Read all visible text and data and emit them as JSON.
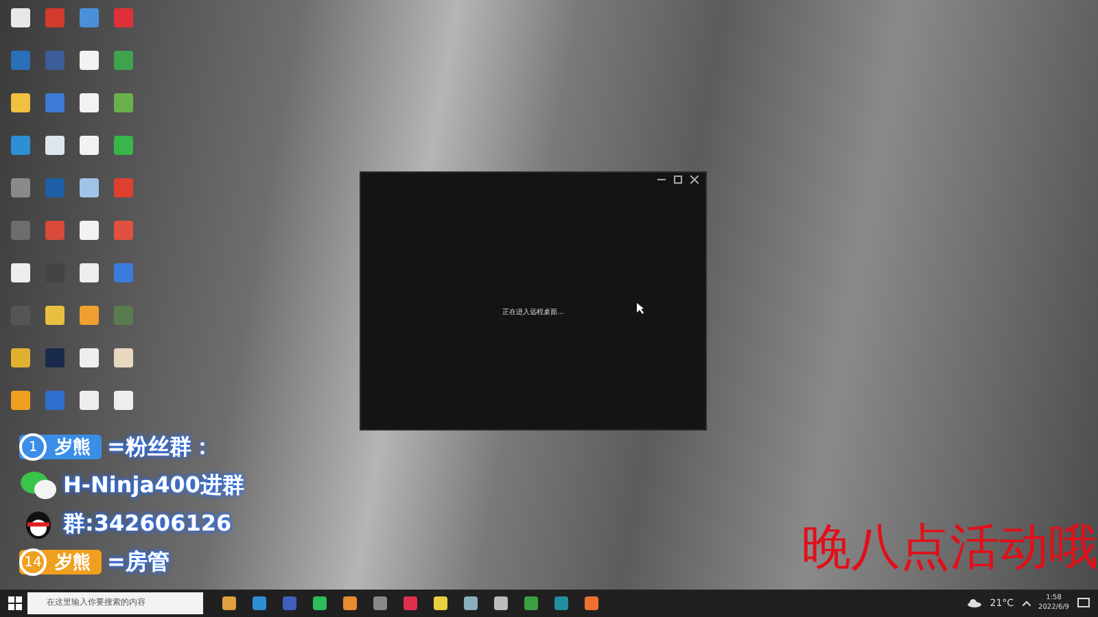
{
  "desktop_icons": [
    {
      "color": "#e8e8e8"
    },
    {
      "color": "#d33b2f"
    },
    {
      "color": "#4a90d9"
    },
    {
      "color": "#e0303a"
    },
    {
      "color": "#2a6fb8"
    },
    {
      "color": "#3c5c9a"
    },
    {
      "color": "#f2f2f2"
    },
    {
      "color": "#3fa34d"
    },
    {
      "color": "#f0c040"
    },
    {
      "color": "#3d7bd6"
    },
    {
      "color": "#f2f2f2"
    },
    {
      "color": "#6ab04c"
    },
    {
      "color": "#2d8fd5"
    },
    {
      "color": "#dfe6ee"
    },
    {
      "color": "#f2f2f2"
    },
    {
      "color": "#39b54a"
    },
    {
      "color": "#8a8a8a"
    },
    {
      "color": "#1e5fa8"
    },
    {
      "color": "#9fc4e8"
    },
    {
      "color": "#e04030"
    },
    {
      "color": "#6d6d6d"
    },
    {
      "color": "#d94a3a"
    },
    {
      "color": "#f2f2f2"
    },
    {
      "color": "#e05040"
    },
    {
      "color": "#eeeeee"
    },
    {
      "color": "#444444"
    },
    {
      "color": "#eeeeee"
    },
    {
      "color": "#3b7bdc"
    },
    {
      "color": "#555555"
    },
    {
      "color": "#e8c040"
    },
    {
      "color": "#f0a030"
    },
    {
      "color": "#5a7a50"
    },
    {
      "color": "#e0b030"
    },
    {
      "color": "#1a2a4a"
    },
    {
      "color": "#eeeeee"
    },
    {
      "color": "#e8d8c0"
    },
    {
      "color": "#f0a020"
    },
    {
      "color": "#2f6fd0"
    },
    {
      "color": "#eeeeee"
    },
    {
      "color": "#eeeeee"
    }
  ],
  "window": {
    "status_text": "正在进入远程桌面..."
  },
  "overlay": {
    "lines": [
      {
        "kind": "badge",
        "level_number": "1",
        "name": "岁熊",
        "text": "=粉丝群：",
        "color": "#3a8ee8"
      },
      {
        "kind": "wechat",
        "text": "H-Ninja400进群"
      },
      {
        "kind": "qq",
        "text": "群:342606126"
      },
      {
        "kind": "badge",
        "level_number": "14",
        "name": "岁熊",
        "text": "=房管",
        "color": "#f0a020"
      }
    ],
    "banner": "晚八点活动哦"
  },
  "taskbar": {
    "search": {
      "placeholder": "在这里输入你要搜索的内容"
    },
    "apps": [
      {
        "color": "#e0a040"
      },
      {
        "color": "#2d8fd5"
      },
      {
        "color": "#4060c0"
      },
      {
        "color": "#2dbd5a"
      },
      {
        "color": "#e88a30"
      },
      {
        "color": "#888888"
      },
      {
        "color": "#e03050"
      },
      {
        "color": "#e8d040"
      },
      {
        "color": "#8ab0c0"
      },
      {
        "color": "#bbbbbb"
      },
      {
        "color": "#3aa040"
      },
      {
        "color": "#2090a0"
      },
      {
        "color": "#f07030"
      }
    ],
    "weather": "21°C",
    "time": "1:58",
    "date": "2022/6/9"
  }
}
